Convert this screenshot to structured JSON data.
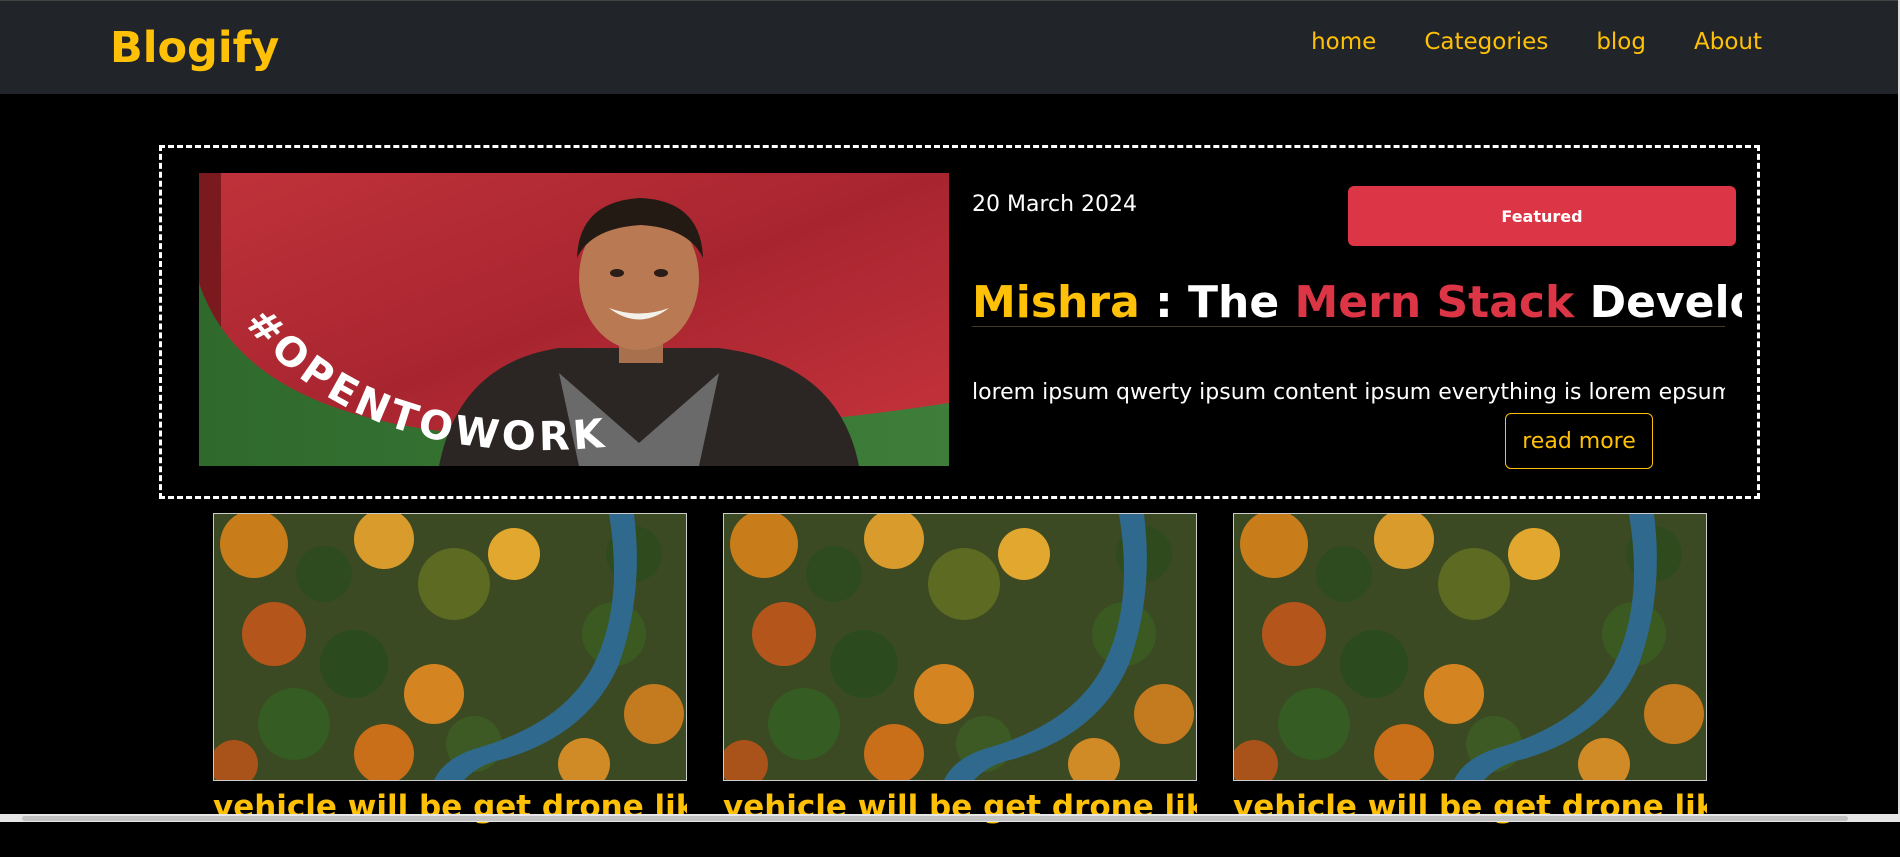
{
  "navbar": {
    "brand": "Blogify",
    "links": [
      {
        "label": "home"
      },
      {
        "label": "Categories"
      },
      {
        "label": "blog"
      },
      {
        "label": "About"
      }
    ]
  },
  "featured": {
    "image_overlay_text": "#OPENTOWORK",
    "date": "20 March 2024",
    "badge": "Featured",
    "title": {
      "part1": "Mishra",
      "part2": " : The ",
      "part3": "Mern Stack",
      "part4": " Developer"
    },
    "description": "lorem ipsum qwerty ipsum content ipsum everything is lorem epsum lorem ipsum",
    "read_more": "read more"
  },
  "cards": [
    {
      "title": "vehicle will be get drone like"
    },
    {
      "title": "vehicle will be get drone like"
    },
    {
      "title": "vehicle will be get drone like"
    }
  ],
  "colors": {
    "accent": "#ffc107",
    "danger": "#dc3545",
    "navbar_bg": "#212529",
    "page_bg": "#000000"
  }
}
